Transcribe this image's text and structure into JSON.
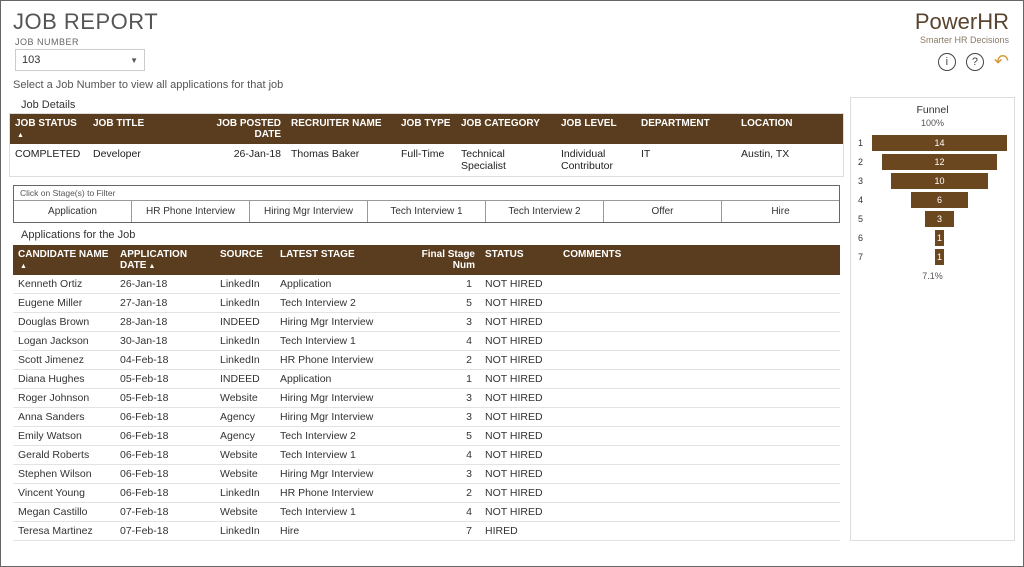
{
  "title": "JOB REPORT",
  "job_number": {
    "label": "JOB NUMBER",
    "value": "103"
  },
  "helper_text": "Select a Job Number to view all applications for that job",
  "brand": {
    "name": "PowerHR",
    "tagline": "Smarter HR Decisions"
  },
  "job_details": {
    "section_label": "Job Details",
    "headers": [
      "JOB STATUS",
      "JOB TITLE",
      "JOB POSTED DATE",
      "RECRUITER NAME",
      "JOB TYPE",
      "JOB CATEGORY",
      "JOB LEVEL",
      "DEPARTMENT",
      "LOCATION"
    ],
    "row": [
      "COMPLETED",
      "Developer",
      "26-Jan-18",
      "Thomas Baker",
      "Full-Time",
      "Technical Specialist",
      "Individual Contributor",
      "IT",
      "Austin, TX"
    ]
  },
  "stage_filter": {
    "hint": "Click on Stage(s) to Filter",
    "stages": [
      "Application",
      "HR Phone Interview",
      "Hiring Mgr Interview",
      "Tech Interview 1",
      "Tech Interview 2",
      "Offer",
      "Hire"
    ]
  },
  "applications": {
    "section_label": "Applications for the Job",
    "headers": [
      "CANDIDATE NAME",
      "APPLICATION DATE",
      "SOURCE",
      "LATEST STAGE",
      "Final Stage Num",
      "STATUS",
      "COMMENTS"
    ],
    "rows": [
      {
        "name": "Kenneth Ortiz",
        "date": "26-Jan-18",
        "source": "LinkedIn",
        "stage": "Application",
        "num": "1",
        "status": "NOT HIRED"
      },
      {
        "name": "Eugene Miller",
        "date": "27-Jan-18",
        "source": "LinkedIn",
        "stage": "Tech Interview 2",
        "num": "5",
        "status": "NOT HIRED"
      },
      {
        "name": "Douglas Brown",
        "date": "28-Jan-18",
        "source": "INDEED",
        "stage": "Hiring Mgr Interview",
        "num": "3",
        "status": "NOT HIRED"
      },
      {
        "name": "Logan Jackson",
        "date": "30-Jan-18",
        "source": "LinkedIn",
        "stage": "Tech Interview 1",
        "num": "4",
        "status": "NOT HIRED"
      },
      {
        "name": "Scott Jimenez",
        "date": "04-Feb-18",
        "source": "LinkedIn",
        "stage": "HR Phone Interview",
        "num": "2",
        "status": "NOT HIRED"
      },
      {
        "name": "Diana Hughes",
        "date": "05-Feb-18",
        "source": "INDEED",
        "stage": "Application",
        "num": "1",
        "status": "NOT HIRED"
      },
      {
        "name": "Roger Johnson",
        "date": "05-Feb-18",
        "source": "Website",
        "stage": "Hiring Mgr Interview",
        "num": "3",
        "status": "NOT HIRED"
      },
      {
        "name": "Anna Sanders",
        "date": "06-Feb-18",
        "source": "Agency",
        "stage": "Hiring Mgr Interview",
        "num": "3",
        "status": "NOT HIRED"
      },
      {
        "name": "Emily Watson",
        "date": "06-Feb-18",
        "source": "Agency",
        "stage": "Tech Interview 2",
        "num": "5",
        "status": "NOT HIRED"
      },
      {
        "name": "Gerald Roberts",
        "date": "06-Feb-18",
        "source": "Website",
        "stage": "Tech Interview 1",
        "num": "4",
        "status": "NOT HIRED"
      },
      {
        "name": "Stephen Wilson",
        "date": "06-Feb-18",
        "source": "Website",
        "stage": "Hiring Mgr Interview",
        "num": "3",
        "status": "NOT HIRED"
      },
      {
        "name": "Vincent Young",
        "date": "06-Feb-18",
        "source": "LinkedIn",
        "stage": "HR Phone Interview",
        "num": "2",
        "status": "NOT HIRED"
      },
      {
        "name": "Megan Castillo",
        "date": "07-Feb-18",
        "source": "Website",
        "stage": "Tech Interview 1",
        "num": "4",
        "status": "NOT HIRED"
      },
      {
        "name": "Teresa Martinez",
        "date": "07-Feb-18",
        "source": "LinkedIn",
        "stage": "Hire",
        "num": "7",
        "status": "HIRED"
      }
    ]
  },
  "funnel": {
    "title": "Funnel",
    "top_pct": "100%",
    "bottom_pct": "7.1%"
  },
  "chart_data": {
    "type": "bar",
    "orientation": "funnel",
    "title": "Funnel",
    "categories": [
      "1",
      "2",
      "3",
      "4",
      "5",
      "6",
      "7"
    ],
    "values": [
      14,
      12,
      10,
      6,
      3,
      1,
      1
    ],
    "top_percentage": 100,
    "bottom_percentage": 7.1,
    "color": "#6b4720"
  }
}
